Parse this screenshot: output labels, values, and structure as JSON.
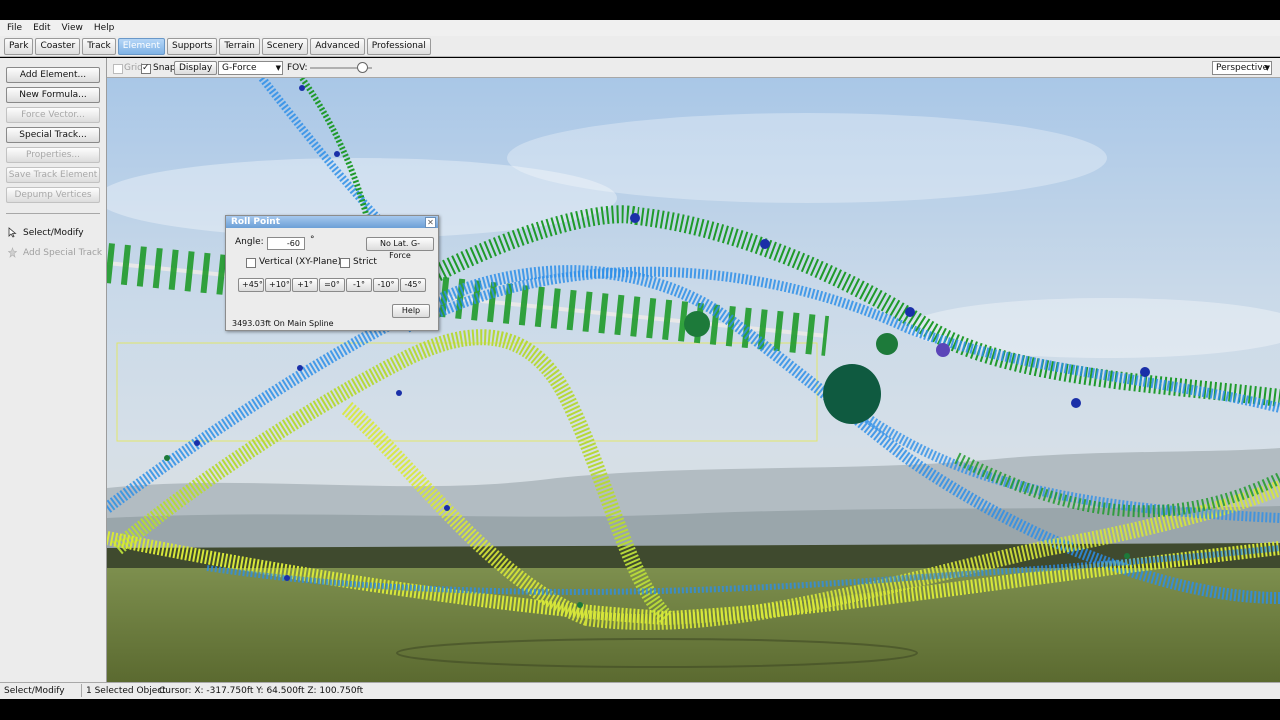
{
  "menu": [
    "File",
    "Edit",
    "View",
    "Help"
  ],
  "tabs": [
    {
      "label": "Park",
      "active": false
    },
    {
      "label": "Coaster",
      "active": false
    },
    {
      "label": "Track",
      "active": false
    },
    {
      "label": "Element",
      "active": true
    },
    {
      "label": "Supports",
      "active": false
    },
    {
      "label": "Terrain",
      "active": false
    },
    {
      "label": "Scenery",
      "active": false
    },
    {
      "label": "Advanced",
      "active": false
    },
    {
      "label": "Professional",
      "active": false
    }
  ],
  "sidebar": {
    "buttons": [
      {
        "label": "Add Element...",
        "enabled": true
      },
      {
        "label": "New Formula...",
        "enabled": true
      },
      {
        "label": "Force Vector...",
        "enabled": false
      },
      {
        "label": "Special Track...",
        "enabled": true
      },
      {
        "label": "Properties...",
        "enabled": false
      },
      {
        "label": "Save Track Element",
        "enabled": false
      },
      {
        "label": "Depump Vertices",
        "enabled": false
      }
    ],
    "tools": [
      {
        "label": "Select/Modify",
        "enabled": true
      },
      {
        "label": "Add Special Track",
        "enabled": false
      }
    ]
  },
  "toolbar": {
    "grid_label": "Grid",
    "grid_checked": false,
    "snap_label": "Snap",
    "snap_checked": true,
    "display_label": "Display",
    "mode_value": "G-Force Comb",
    "fov_label": "FOV:",
    "fov_level": 0.9,
    "view_value": "Perspective"
  },
  "dialog": {
    "title": "Roll Point",
    "angle_label": "Angle:",
    "angle_value": "-60",
    "angle_unit": "°",
    "no_lat_button": "No Lat. G-Force",
    "vertical_label": "Vertical (XY-Plane)",
    "vertical_checked": false,
    "strict_label": "Strict",
    "strict_checked": false,
    "step_buttons": [
      "+45°",
      "+10°",
      "+1°",
      "=0°",
      "-1°",
      "-10°",
      "-45°"
    ],
    "help_button": "Help",
    "position_text": "3493.03ft On Main Spline"
  },
  "status": {
    "mode": "Select/Modify",
    "selection": "1 Selected Object",
    "cursor": "Cursor: X: -317.750ft Y: 64.500ft Z: 100.750ft"
  },
  "colors": {
    "accent": "#7fb2e5",
    "track_green": "#1f9a2a",
    "track_blue": "#2d8ee8",
    "track_yellow": "#d8e83a",
    "node_dark_green": "#0f5a40",
    "node_blue": "#1a2fa8"
  }
}
